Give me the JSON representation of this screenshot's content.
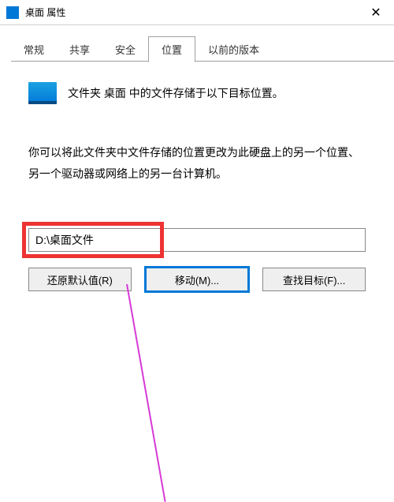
{
  "titlebar": {
    "title": "桌面 属性"
  },
  "tabs": [
    {
      "label": "常规"
    },
    {
      "label": "共享"
    },
    {
      "label": "安全"
    },
    {
      "label": "位置"
    },
    {
      "label": "以前的版本"
    }
  ],
  "main": {
    "heading": "文件夹 桌面 中的文件存储于以下目标位置。",
    "description": "你可以将此文件夹中文件存储的位置更改为此硬盘上的另一个位置、另一个驱动器或网络上的另一台计算机。",
    "path_value": "D:\\桌面文件",
    "buttons": {
      "restore": "还原默认值(R)",
      "move": "移动(M)...",
      "find": "查找目标(F)..."
    }
  }
}
